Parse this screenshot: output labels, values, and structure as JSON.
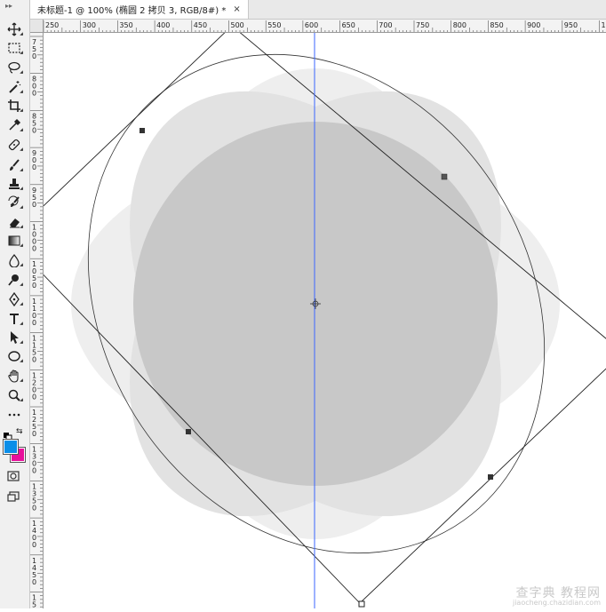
{
  "document_tab": {
    "title": "未标题-1 @ 100% (椭圆 2 拷贝 3, RGB/8#) *",
    "close": "×"
  },
  "ruler_top": {
    "labels": [
      "250",
      "300",
      "350",
      "400",
      "450",
      "500",
      "550",
      "600",
      "650",
      "700",
      "750",
      "800",
      "850",
      "900",
      "950",
      "10"
    ]
  },
  "ruler_left": {
    "labels": [
      "750",
      "800",
      "850",
      "900",
      "950",
      "1000",
      "1050",
      "1100",
      "1150",
      "1200",
      "1250",
      "1300",
      "1350",
      "1400",
      "1450",
      "1500"
    ]
  },
  "tools": [
    {
      "name": "move-tool-icon"
    },
    {
      "name": "marquee-tool-icon"
    },
    {
      "name": "lasso-tool-icon"
    },
    {
      "name": "magic-wand-tool-icon"
    },
    {
      "name": "crop-tool-icon"
    },
    {
      "name": "eyedropper-tool-icon"
    },
    {
      "name": "healing-brush-tool-icon"
    },
    {
      "name": "brush-tool-icon"
    },
    {
      "name": "clone-stamp-tool-icon"
    },
    {
      "name": "history-brush-tool-icon"
    },
    {
      "name": "eraser-tool-icon"
    },
    {
      "name": "gradient-tool-icon"
    },
    {
      "name": "blur-tool-icon"
    },
    {
      "name": "dodge-tool-icon"
    },
    {
      "name": "pen-tool-icon"
    },
    {
      "name": "type-tool-icon"
    },
    {
      "name": "path-selection-tool-icon"
    },
    {
      "name": "ellipse-tool-icon"
    },
    {
      "name": "hand-tool-icon"
    },
    {
      "name": "zoom-tool-icon"
    },
    {
      "name": "more-tools-icon"
    }
  ],
  "colors": {
    "foreground": "#0a8ee8",
    "background": "#e8109b",
    "guide": "#3b66ff",
    "ellipse_fill": "#c8c8c8",
    "ellipse_fill_light": "#eeeeee"
  },
  "watermark": {
    "line1": "查字典 教程网",
    "line2": "jiaocheng.chazidian.com"
  }
}
